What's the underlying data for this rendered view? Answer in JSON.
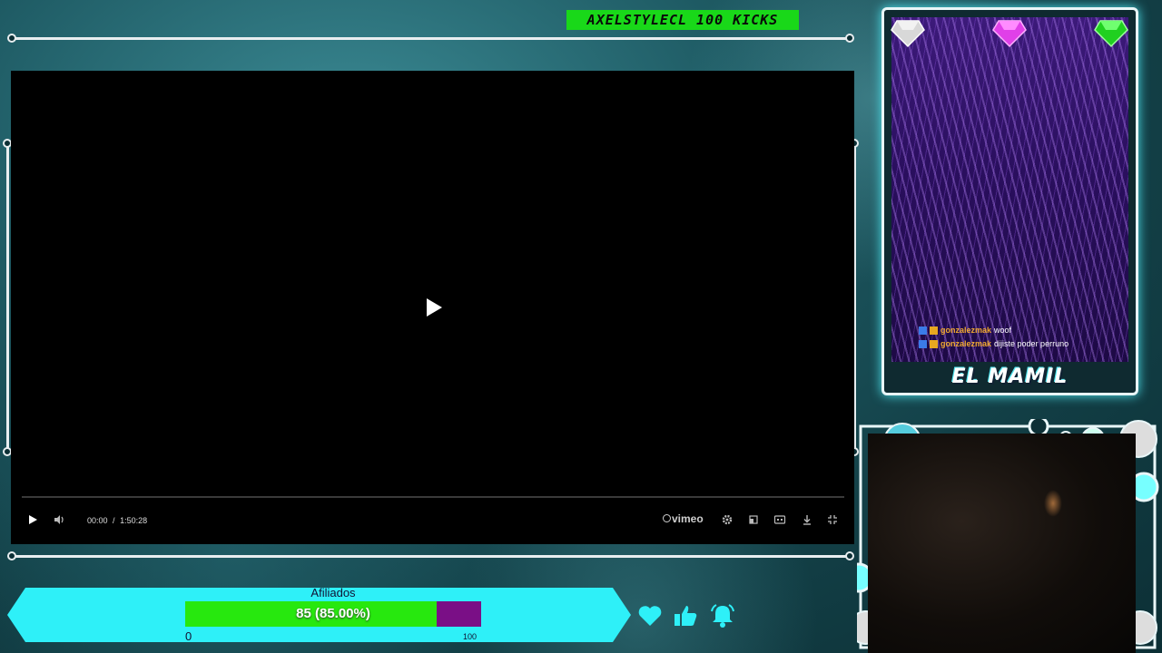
{
  "banner": {
    "kicks_text": "AXELSTYLECL 100 KICKS"
  },
  "player": {
    "time_current": "00:00",
    "time_separator": "/",
    "time_total": "1:50:28",
    "brand": "vimeo",
    "progress_fraction": 0.0,
    "icons": [
      "play-icon",
      "volume-icon",
      "settings-icon",
      "pip-icon",
      "captions-icon",
      "download-icon",
      "exit-fullscreen-icon"
    ]
  },
  "card": {
    "name": "EL MAMIL",
    "gem_colors": [
      "#d8d8d8",
      "#e040e8",
      "#20d020"
    ],
    "chat": [
      {
        "user": "gonzalezmak",
        "message": "woof"
      },
      {
        "user": "gonzalezmak",
        "message": "dijiste poder perruno"
      }
    ]
  },
  "goal": {
    "title": "Afiliados",
    "progress_label": "85 (85.00%)",
    "current": 85,
    "percent": 85.0,
    "min_label": "0",
    "max_label": "100",
    "fill_color": "#27e80e",
    "remaining_color": "#7a0f86"
  },
  "social": {
    "icons": [
      "heart-icon",
      "thumbs-up-icon",
      "bell-icon"
    ],
    "color": "#2ef0f8"
  }
}
